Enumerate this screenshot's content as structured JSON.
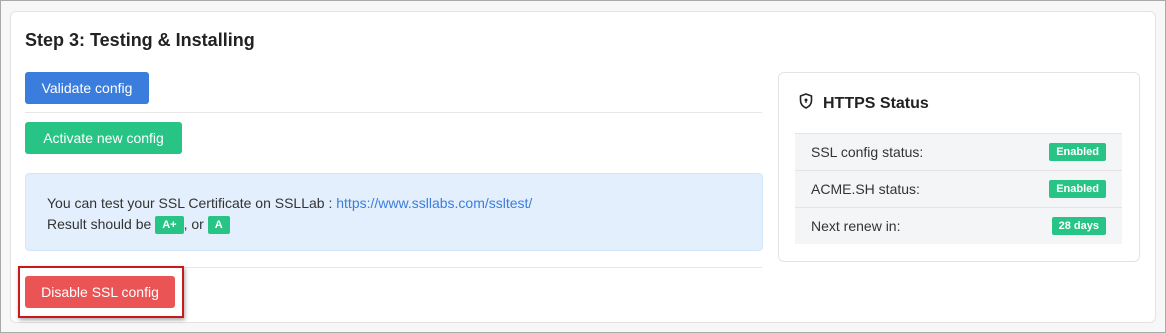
{
  "step": {
    "title": "Step 3: Testing & Installing",
    "validate_label": "Validate config",
    "activate_label": "Activate new config",
    "disable_label": "Disable SSL config"
  },
  "alert": {
    "text_prefix": "You can test your SSL Certificate on SSLLab : ",
    "link_text": "https://www.ssllabs.com/ssltest/",
    "result_prefix": "Result should be ",
    "grade_a_plus": "A+",
    "separator": ", or",
    "grade_a": "A"
  },
  "https_status": {
    "title": "HTTPS Status",
    "icon": "shield-icon",
    "rows": [
      {
        "label": "SSL config status:",
        "value": "Enabled"
      },
      {
        "label": "ACME.SH status:",
        "value": "Enabled"
      },
      {
        "label": "Next renew in:",
        "value": "28 days"
      }
    ]
  },
  "colors": {
    "primary": "#3b7ddd",
    "success": "#28c486",
    "danger": "#ea5455",
    "highlight": "#c8191c"
  }
}
